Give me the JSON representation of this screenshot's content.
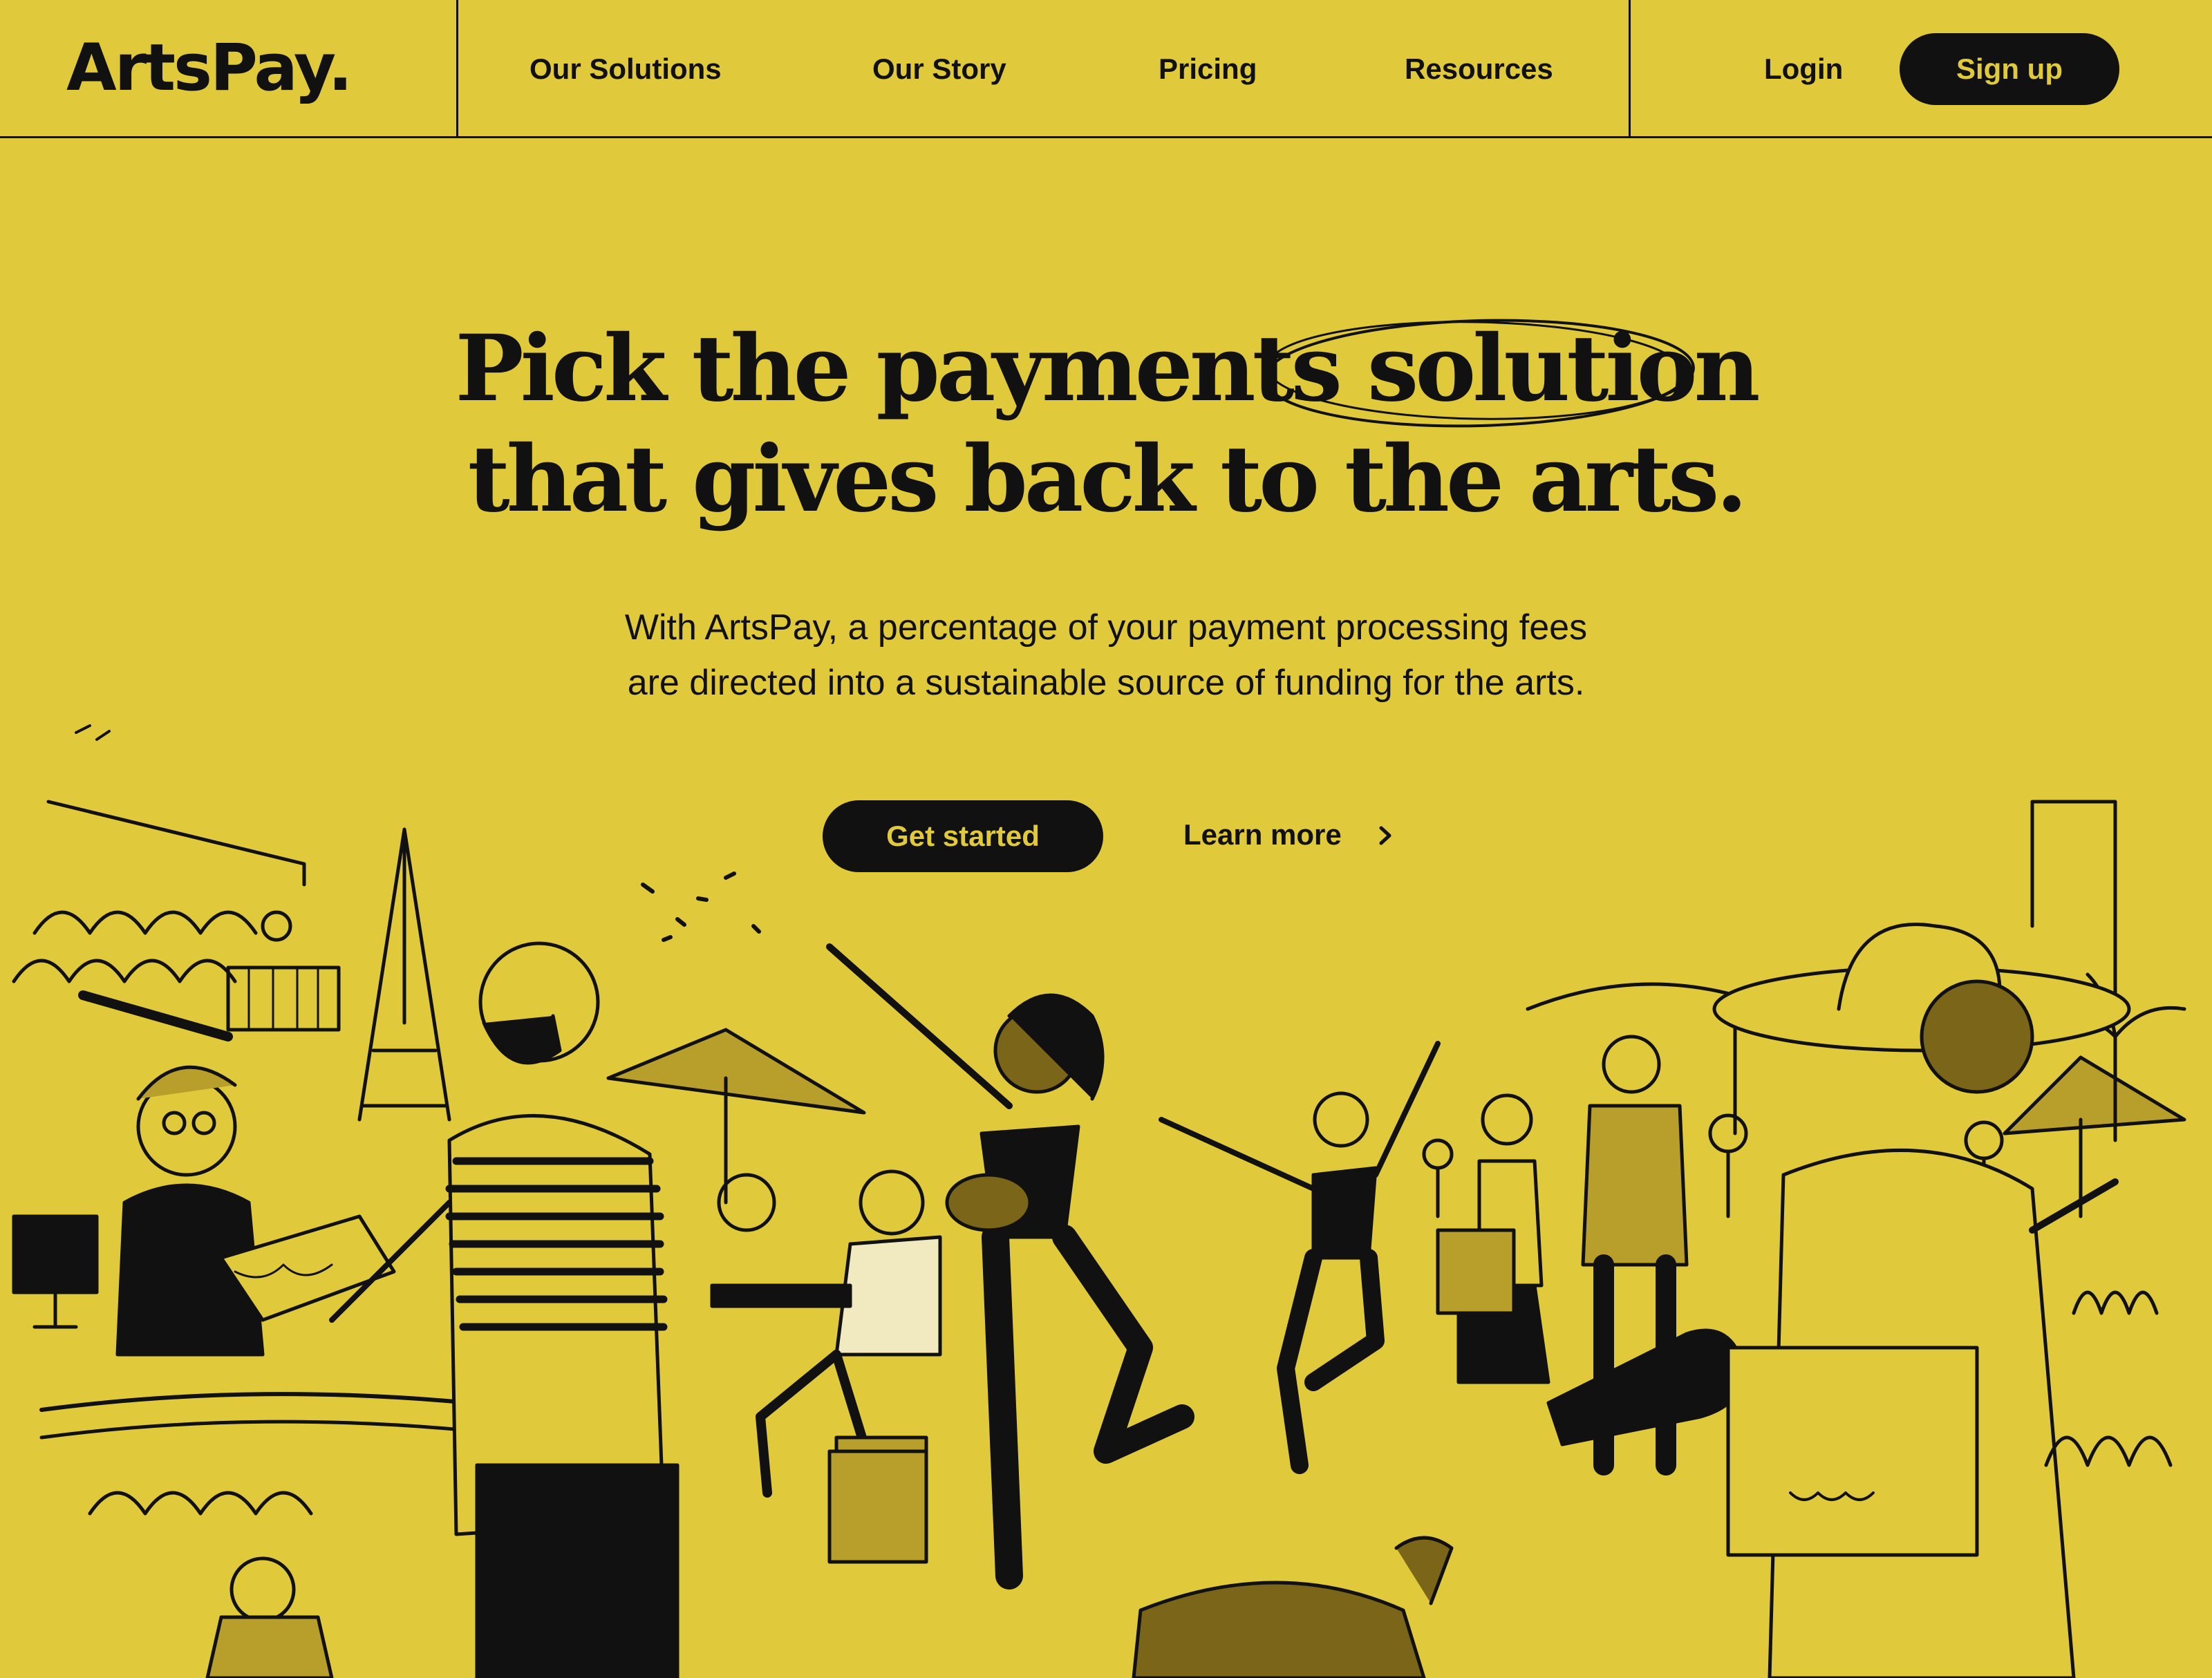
{
  "brand": {
    "logo": "ArtsPay.",
    "accent": "#e0c93b",
    "ink": "#111111"
  },
  "nav": {
    "items": [
      "Our Solutions",
      "Our Story",
      "Pricing",
      "Resources"
    ],
    "login": "Login",
    "signup": "Sign up"
  },
  "hero": {
    "title_line1_a": "Pick the payments",
    "title_line1_b": "solution",
    "title_line2": "that gives back to the arts.",
    "subtitle_line1": "With ArtsPay, a percentage of your payment processing fees",
    "subtitle_line2": "are directed into a sustainable source of funding for the arts.",
    "cta_primary": "Get started",
    "cta_secondary": "Learn more",
    "cta_secondary_icon": "chevron-right-icon"
  },
  "illustration": {
    "icon": "arts-street-scene-illustration"
  }
}
